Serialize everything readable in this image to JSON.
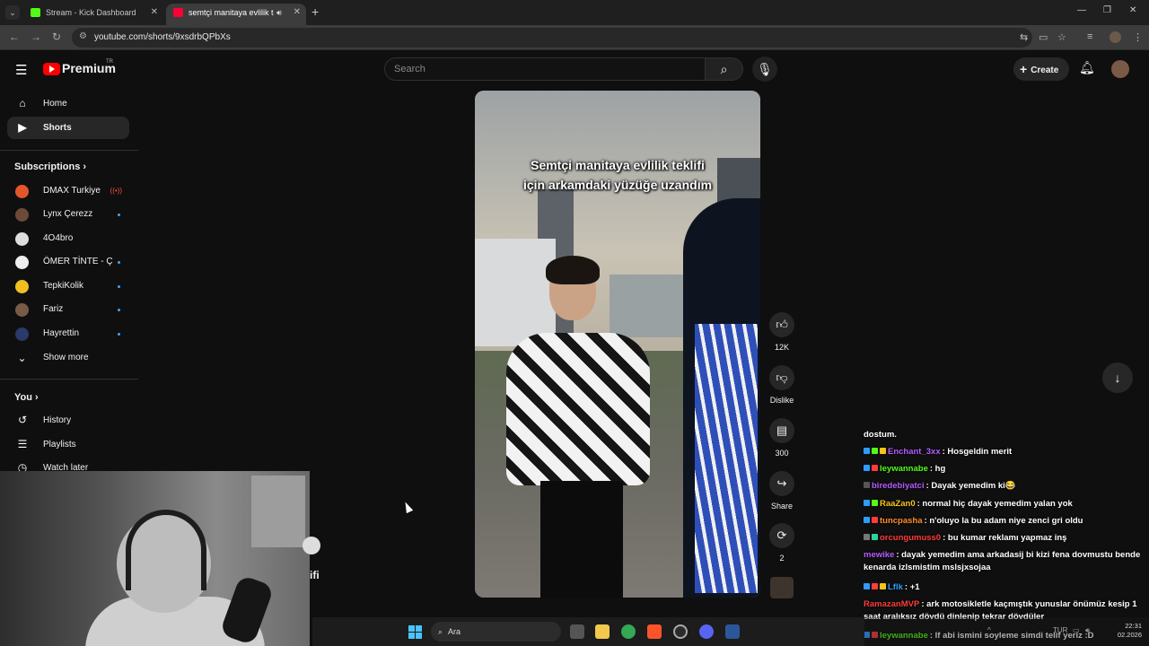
{
  "browser": {
    "tabs": [
      {
        "title": "Stream - Kick Dashboard"
      },
      {
        "title": "semtçi manitaya evlilik tekli"
      }
    ],
    "url": "youtube.com/shorts/9xsdrbQPbXs"
  },
  "header": {
    "logo_text": "Premium",
    "logo_region": "TR",
    "search_placeholder": "Search",
    "create_label": "Create"
  },
  "sidebar": {
    "home": "Home",
    "shorts": "Shorts",
    "subscriptions_title": "Subscriptions",
    "subscriptions": [
      {
        "name": "DMAX Turkiye",
        "color": "#e3562a",
        "live": true
      },
      {
        "name": "Lynx Çerezz",
        "color": "#6b4a3a",
        "dot": true
      },
      {
        "name": "4O4bro",
        "color": "#dddddd",
        "dot": false
      },
      {
        "name": "ÖMER TİNTE - Çİ...",
        "color": "#eeeeee",
        "dot": true
      },
      {
        "name": "TepkiKolik",
        "color": "#f0c020",
        "dot": true
      },
      {
        "name": "Fariz",
        "color": "#7a5a46",
        "dot": true
      },
      {
        "name": "Hayrettin",
        "color": "#2a3a6a",
        "dot": true
      }
    ],
    "live_icon": "((•))",
    "show_more": "Show more",
    "you_title": "You",
    "you_items": [
      "History",
      "Playlists",
      "Watch later"
    ]
  },
  "short": {
    "caption_line1": "Semtçi manitaya evlilik teklifi",
    "caption_line2": "için arkamdaki yüzüğe uzandım",
    "likes": "12K",
    "dislike_label": "Dislike",
    "comments": "300",
    "share_label": "Share",
    "remix_count": "2"
  },
  "overlay_text": "ifi",
  "chat": {
    "messages": [
      {
        "user": "",
        "text": "dostum.",
        "color": "#ffffff",
        "badges": []
      },
      {
        "user": "Enchant_3xx",
        "text": ": Hosgeldin merit",
        "color": "#b45cff",
        "badges": [
          "#2f9bff",
          "#53fc18",
          "#f5c518"
        ]
      },
      {
        "user": "leywannabe",
        "text": ": hg",
        "color": "#53fc18",
        "badges": [
          "#2f9bff",
          "#ff3b3b"
        ]
      },
      {
        "user": "biredebiyatci",
        "text": ": Dayak yemedim ki😂",
        "color": "#b45cff",
        "badges": [
          "#555555"
        ]
      },
      {
        "user": "RaaZan0",
        "text": ": normal hiç dayak yemedim yalan yok",
        "color": "#f5c518",
        "badges": [
          "#2f9bff",
          "#53fc18"
        ]
      },
      {
        "user": "tuncpasha",
        "text": ": n'oluyo la bu adam niye zenci gri oldu",
        "color": "#ff8c2e",
        "badges": [
          "#2f9bff",
          "#ff3b3b"
        ]
      },
      {
        "user": "orcungumuss0",
        "text": ": bu kumar reklamı yapmaz inş",
        "color": "#ff3b3b",
        "badges": [
          "#777777",
          "#2fd0a0"
        ]
      },
      {
        "user": "mewike",
        "text": ": dayak yemedim ama arkadasij bi kizi fena dovmustu bende kenarda izlsmistim mslsjxsojaa",
        "color": "#b45cff",
        "badges": []
      },
      {
        "user": "Lflk",
        "text": ": +1",
        "color": "#2f9bff",
        "badges": [
          "#2f9bff",
          "#ff3b3b",
          "#f5c518"
        ]
      },
      {
        "user": "RamazanMVP",
        "text": ": ark motosikletle kaçmıştık yunuslar önümüz kesip 1 saat aralıksız dövdü dinlenip tekrar dövdüler",
        "color": "#ff3b3b",
        "badges": []
      },
      {
        "user": "leywannabe",
        "text": ": lf abi ismini soyleme simdi telif yeriz :D",
        "color": "#53fc18",
        "badges": [
          "#2f9bff",
          "#ff3b3b"
        ]
      }
    ]
  },
  "taskbar": {
    "search_label": "Ara",
    "lang": "TUR",
    "time": "22:31",
    "date": "02.2026"
  }
}
